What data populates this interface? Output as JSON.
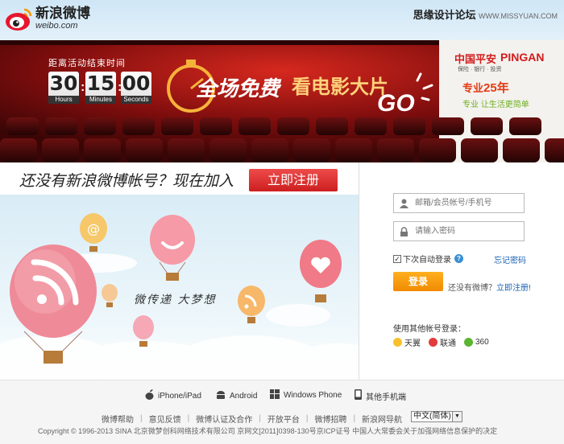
{
  "header": {
    "logo_cn": "新浪微博",
    "logo_en": "weibo.com",
    "watermark_title": "思缘设计论坛",
    "watermark_url": "WWW.MISSYUAN.COM"
  },
  "banner": {
    "countdown_title": "距离活动结束时间",
    "countdown": [
      {
        "value": "30",
        "unit": "Hours"
      },
      {
        "value": "15",
        "unit": "Minutes"
      },
      {
        "value": "00",
        "unit": "Seconds"
      }
    ],
    "promo_main": "全场免费",
    "promo_sub": "看电影大片",
    "promo_go": "GO",
    "sponsor_cn": "中国平安",
    "sponsor_en": "PINGAN",
    "sponsor_sub": "保险 · 银行 · 投资",
    "pro_line1": "专业",
    "pro_line1_num": "25年",
    "pro_line2": "专业 让生活更简单"
  },
  "join": {
    "text": "还没有新浪微博帐号？现在加入",
    "register_label": "立即注册"
  },
  "sky": {
    "slogan": "微传递 大梦想"
  },
  "login": {
    "username_placeholder": "邮箱/会员帐号/手机号",
    "password_placeholder": "请输入密码",
    "remember_label": "下次自动登录",
    "help_icon": "?",
    "forgot_label": "忘记密码",
    "login_label": "登录",
    "no_account_text": "还没有微博？",
    "register_link": "立即注册!",
    "other_title": "使用其他帐号登录：",
    "other_accounts": [
      "天翼",
      "联通",
      "360"
    ]
  },
  "footer": {
    "platforms": [
      "iPhone/iPad",
      "Android",
      "Windows Phone",
      "其他手机端"
    ],
    "links": [
      "微博帮助",
      "意见反馈",
      "微博认证及合作",
      "开放平台",
      "微博招聘",
      "新浪网导航"
    ],
    "language": "中文(简体)",
    "copyright": "Copyright © 1996-2013 SINA 北京微梦创科网络技术有限公司    京网文[2011]0398-130号京ICP证号    中国人大常委会关于加强网络信息保护的决定"
  },
  "colors": {
    "register_red": "#cc1f1f",
    "login_orange": "#f08a00",
    "link_blue": "#1c63b8"
  }
}
